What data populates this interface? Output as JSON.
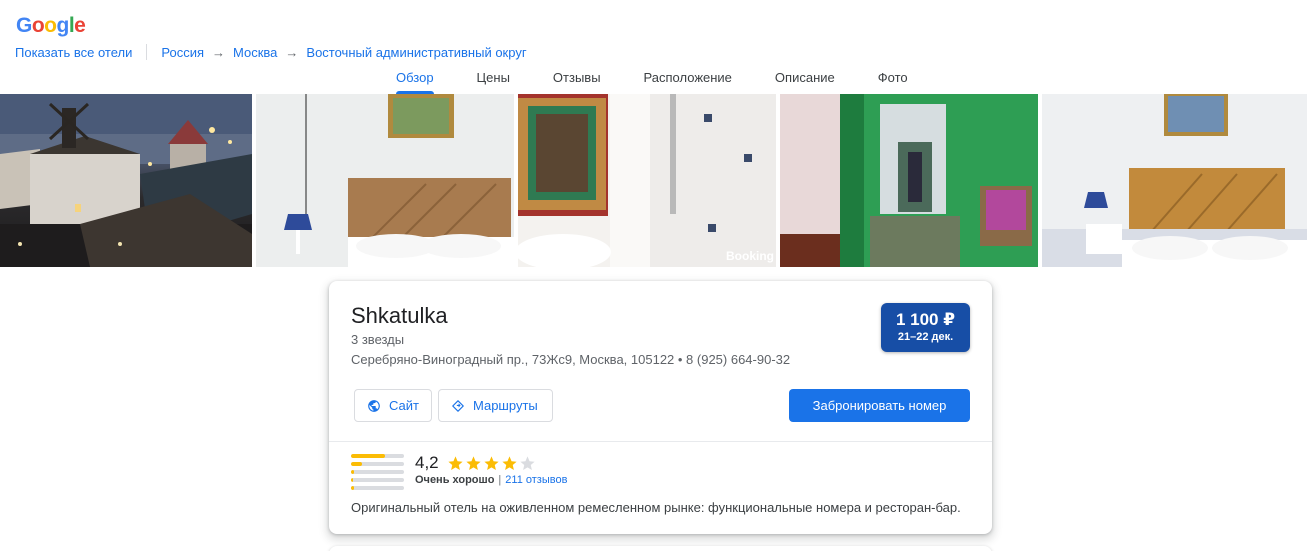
{
  "logo": {
    "letters": [
      {
        "ch": "G",
        "color": "#4285F4"
      },
      {
        "ch": "o",
        "color": "#EA4335"
      },
      {
        "ch": "o",
        "color": "#FBBC05"
      },
      {
        "ch": "g",
        "color": "#4285F4"
      },
      {
        "ch": "l",
        "color": "#34A853"
      },
      {
        "ch": "e",
        "color": "#EA4335"
      }
    ]
  },
  "breadcrumb": {
    "all_hotels": "Показать все отели",
    "items": [
      "Россия",
      "Москва",
      "Восточный административный округ"
    ],
    "arrow": "→"
  },
  "tabs": [
    {
      "label": "Обзор",
      "active": true
    },
    {
      "label": "Цены",
      "active": false
    },
    {
      "label": "Отзывы",
      "active": false
    },
    {
      "label": "Расположение",
      "active": false
    },
    {
      "label": "Описание",
      "active": false
    },
    {
      "label": "Фото",
      "active": false
    }
  ],
  "photos": {
    "watermark": "Booking"
  },
  "hotel": {
    "name": "Shkatulka",
    "stars_text": "3 звезды",
    "address": "Серебряно-Виноградный пр., 73Жс9, Москва, 105122 • 8 (925) 664-90-32",
    "price": "1 100 ₽",
    "dates": "21–22 дек.",
    "site_label": "Сайт",
    "routes_label": "Маршруты",
    "book_label": "Забронировать номер",
    "rating": "4,2",
    "rating_stars": 4,
    "rating_word": "Очень хорошо",
    "reviews": "211 отзывов",
    "rating_distribution": [
      0.65,
      0.2,
      0.06,
      0.03,
      0.06
    ],
    "description": "Оригинальный отель на оживленном ремесленном рынке: функциональные номера и ресторан-бар."
  },
  "colors": {
    "accent": "#1a73e8",
    "price_bg": "#174ea6",
    "star": "#fbbc04"
  }
}
